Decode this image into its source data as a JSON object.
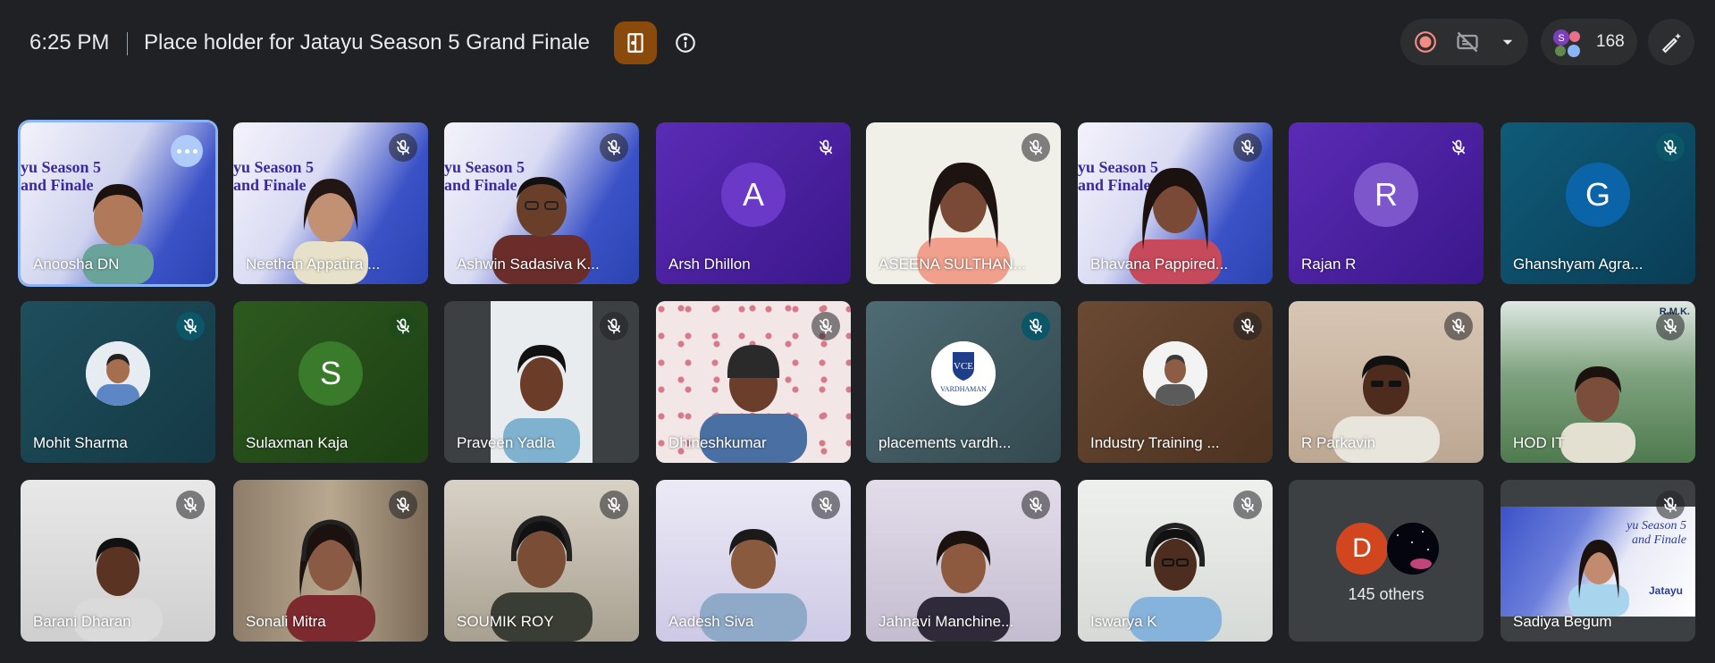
{
  "header": {
    "time": "6:25 PM",
    "meeting_title": "Place holder for Jatayu Season 5 Grand Finale",
    "participant_count": "168",
    "mini_avatar_letter": "S"
  },
  "tiles": [
    {
      "name": "Anoosha DN",
      "type": "video",
      "active": true
    },
    {
      "name": "Neethan Appatira ...",
      "type": "video"
    },
    {
      "name": "Ashwin Sadasiva K...",
      "type": "video"
    },
    {
      "name": "Arsh Dhillon",
      "type": "letter",
      "letter": "A"
    },
    {
      "name": "ASEENA SULTHAN...",
      "type": "video"
    },
    {
      "name": "Bhavana Pappired...",
      "type": "video"
    },
    {
      "name": "Rajan R",
      "type": "letter",
      "letter": "R"
    },
    {
      "name": "Ghanshyam Agra...",
      "type": "letter",
      "letter": "G"
    },
    {
      "name": "Mohit Sharma",
      "type": "photo"
    },
    {
      "name": "Sulaxman Kaja",
      "type": "letter",
      "letter": "S"
    },
    {
      "name": "Praveen Yadla",
      "type": "video"
    },
    {
      "name": "Dhineshkumar",
      "type": "video"
    },
    {
      "name": "placements vardh...",
      "type": "logo"
    },
    {
      "name": "Industry Training ...",
      "type": "photo"
    },
    {
      "name": "R Parkavin",
      "type": "video"
    },
    {
      "name": "HOD IT",
      "type": "video"
    },
    {
      "name": "Barani Dharan",
      "type": "video"
    },
    {
      "name": "Sonali Mitra",
      "type": "video"
    },
    {
      "name": "SOUMIK ROY",
      "type": "video"
    },
    {
      "name": "Aadesh Siva",
      "type": "video"
    },
    {
      "name": "Jahnavi Manchine...",
      "type": "video"
    },
    {
      "name": "Iswarya K",
      "type": "video"
    },
    {
      "name": "Sadiya Begum",
      "type": "video"
    }
  ],
  "banner": {
    "line1": "yu Season 5",
    "line2": "and Finale",
    "brand": "Jatayu"
  },
  "logos": {
    "vce": "VCE",
    "vardhaman": "VARDHAMAN",
    "rmk": "R.M.K."
  },
  "others": {
    "letter": "D",
    "label": "145 others"
  },
  "colors": {
    "background": "#202124",
    "accent": "#8ab4f8",
    "door_button": "#8a4a0b"
  }
}
